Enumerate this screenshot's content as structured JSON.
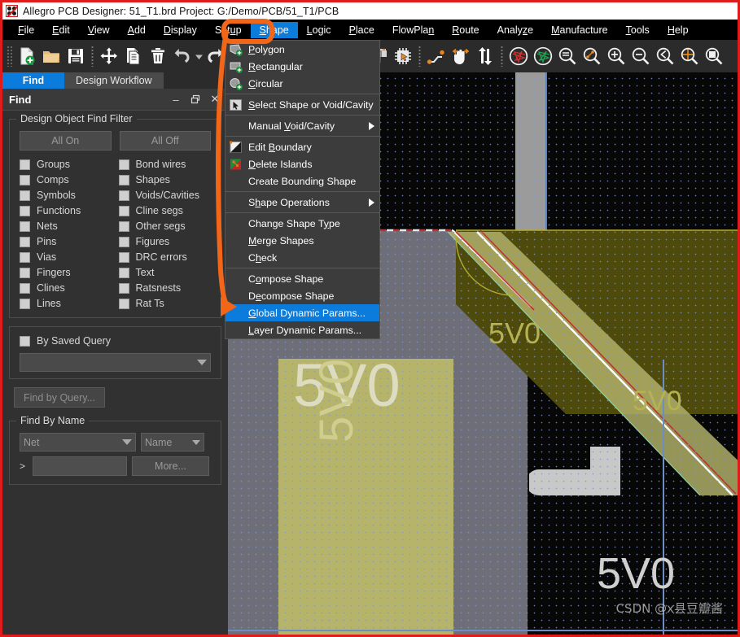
{
  "window": {
    "title": "Allegro PCB Designer: 51_T1.brd  Project: G:/Demo/PCB/51_T1/PCB",
    "app_icon": "allegro-icon",
    "frame_color": "#e01b1b"
  },
  "menubar": {
    "items": [
      {
        "label": "File",
        "mnemonic": "F",
        "active": false
      },
      {
        "label": "Edit",
        "mnemonic": "E",
        "active": false
      },
      {
        "label": "View",
        "mnemonic": "V",
        "active": false
      },
      {
        "label": "Add",
        "mnemonic": "A",
        "active": false
      },
      {
        "label": "Display",
        "mnemonic": "D",
        "active": false
      },
      {
        "label": "Setup",
        "mnemonic": "u",
        "active": false
      },
      {
        "label": "Shape",
        "mnemonic": "S",
        "active": true
      },
      {
        "label": "Logic",
        "mnemonic": "L",
        "active": false
      },
      {
        "label": "Place",
        "mnemonic": "P",
        "active": false
      },
      {
        "label": "FlowPlan",
        "mnemonic": "n",
        "active": false
      },
      {
        "label": "Route",
        "mnemonic": "R",
        "active": false
      },
      {
        "label": "Analyze",
        "mnemonic": "z",
        "active": false
      },
      {
        "label": "Manufacture",
        "mnemonic": "M",
        "active": false
      },
      {
        "label": "Tools",
        "mnemonic": "T",
        "active": false
      },
      {
        "label": "Help",
        "mnemonic": "H",
        "active": false
      }
    ],
    "highlight_color": "#0c7cdc"
  },
  "toolbar": {
    "buttons": [
      {
        "name": "new-file-icon"
      },
      {
        "name": "open-folder-icon"
      },
      {
        "name": "save-icon"
      },
      {
        "name": "move-icon"
      },
      {
        "name": "copy-icon"
      },
      {
        "name": "delete-trash-icon"
      },
      {
        "name": "undo-icon"
      },
      {
        "name": "redo-icon"
      },
      {
        "name": "padstack-icon"
      },
      {
        "name": "component-select-icon"
      },
      {
        "name": "add-connect-icon"
      },
      {
        "name": "slide-hand-icon"
      },
      {
        "name": "swap-icon"
      },
      {
        "name": "ratsnest-off-icon"
      },
      {
        "name": "ratsnest-on-icon"
      },
      {
        "name": "zoom-fit-icon"
      },
      {
        "name": "zoom-by-points-icon"
      },
      {
        "name": "zoom-in-icon"
      },
      {
        "name": "zoom-out-icon"
      },
      {
        "name": "zoom-previous-icon"
      },
      {
        "name": "zoom-center-icon"
      },
      {
        "name": "zoom-world-icon"
      }
    ]
  },
  "left_panel": {
    "tabs": [
      {
        "label": "Find",
        "selected": true
      },
      {
        "label": "Design Workflow",
        "selected": false
      }
    ],
    "find_window": {
      "title": "Find",
      "minimize_glyph": "–",
      "restore_glyph": "❐",
      "close_glyph": "✕",
      "filter_group_label": "Design Object Find Filter",
      "all_on_label": "All On",
      "all_off_label": "All Off",
      "checkboxes_left": [
        "Groups",
        "Comps",
        "Symbols",
        "Functions",
        "Nets",
        "Pins",
        "Vias",
        "Fingers",
        "Clines",
        "Lines"
      ],
      "checkboxes_right": [
        "Bond wires",
        "Shapes",
        "Voids/Cavities",
        "Cline segs",
        "Other segs",
        "Figures",
        "DRC errors",
        "Text",
        "Ratsnests",
        "Rat Ts"
      ],
      "by_saved_query_label": "By Saved Query",
      "saved_query_value": "",
      "find_by_query_label": "Find by Query...",
      "find_by_name_group_label": "Find By Name",
      "name_type_value": "Net",
      "name_mode_value": "Name",
      "prompt_glyph": ">",
      "name_field_value": "",
      "more_label": "More..."
    }
  },
  "shape_menu": {
    "highlight_color": "#0c7cdc",
    "items": [
      {
        "label": "Polygon",
        "mnemonic": "P",
        "icon": "polygon-shape-icon",
        "selected": false,
        "submenu": false,
        "separator_after": false
      },
      {
        "label": "Rectangular",
        "mnemonic": "R",
        "icon": "rectangle-shape-icon",
        "selected": false,
        "submenu": false,
        "separator_after": false
      },
      {
        "label": "Circular",
        "mnemonic": "C",
        "icon": "circle-shape-icon",
        "selected": false,
        "submenu": false,
        "separator_after": true
      },
      {
        "label": "Select Shape or Void/Cavity",
        "mnemonic": "S",
        "icon": "select-shape-icon",
        "selected": false,
        "submenu": false,
        "separator_after": true
      },
      {
        "label": "Manual Void/Cavity",
        "mnemonic": "V",
        "icon": "none",
        "selected": false,
        "submenu": true,
        "separator_after": true
      },
      {
        "label": "Edit Boundary",
        "mnemonic": "B",
        "icon": "edit-boundary-icon",
        "selected": false,
        "submenu": false,
        "separator_after": false
      },
      {
        "label": "Delete Islands",
        "mnemonic": "D",
        "icon": "delete-islands-icon",
        "selected": false,
        "submenu": false,
        "separator_after": false
      },
      {
        "label": "Create Bounding Shape",
        "mnemonic": "",
        "icon": "none",
        "selected": false,
        "submenu": false,
        "separator_after": true
      },
      {
        "label": "Shape Operations",
        "mnemonic": "h",
        "icon": "none",
        "selected": false,
        "submenu": true,
        "separator_after": true
      },
      {
        "label": "Change Shape Type",
        "mnemonic": "y",
        "icon": "none",
        "selected": false,
        "submenu": false,
        "separator_after": false
      },
      {
        "label": "Merge Shapes",
        "mnemonic": "M",
        "icon": "none",
        "selected": false,
        "submenu": false,
        "separator_after": false
      },
      {
        "label": "Check",
        "mnemonic": "h",
        "icon": "none",
        "selected": false,
        "submenu": false,
        "separator_after": true
      },
      {
        "label": "Compose Shape",
        "mnemonic": "o",
        "icon": "none",
        "selected": false,
        "submenu": false,
        "separator_after": false
      },
      {
        "label": "Decompose Shape",
        "mnemonic": "e",
        "icon": "none",
        "selected": false,
        "submenu": false,
        "separator_after": false
      },
      {
        "label": "Global Dynamic Params...",
        "mnemonic": "G",
        "icon": "none",
        "selected": true,
        "submenu": false,
        "separator_after": false
      },
      {
        "label": "Layer Dynamic Params...",
        "mnemonic": "L",
        "icon": "none",
        "selected": false,
        "submenu": false,
        "separator_after": false
      }
    ]
  },
  "canvas": {
    "net_labels": [
      "5V0",
      "5V0",
      "5V0",
      "5V0",
      "5V0"
    ],
    "background_color": "#060606",
    "grid_dot_color": "#7a96dc",
    "copper_plane_color": "#b6b46a",
    "shape_gray_color": "#7a7a86",
    "dark_olive_color": "#4d4a08"
  },
  "annotation": {
    "color": "#f2661a",
    "highlight_target": "Shape",
    "arrow_target": "Global Dynamic Params..."
  },
  "watermark": {
    "text": "CSDN @x县豆瓣酱"
  }
}
